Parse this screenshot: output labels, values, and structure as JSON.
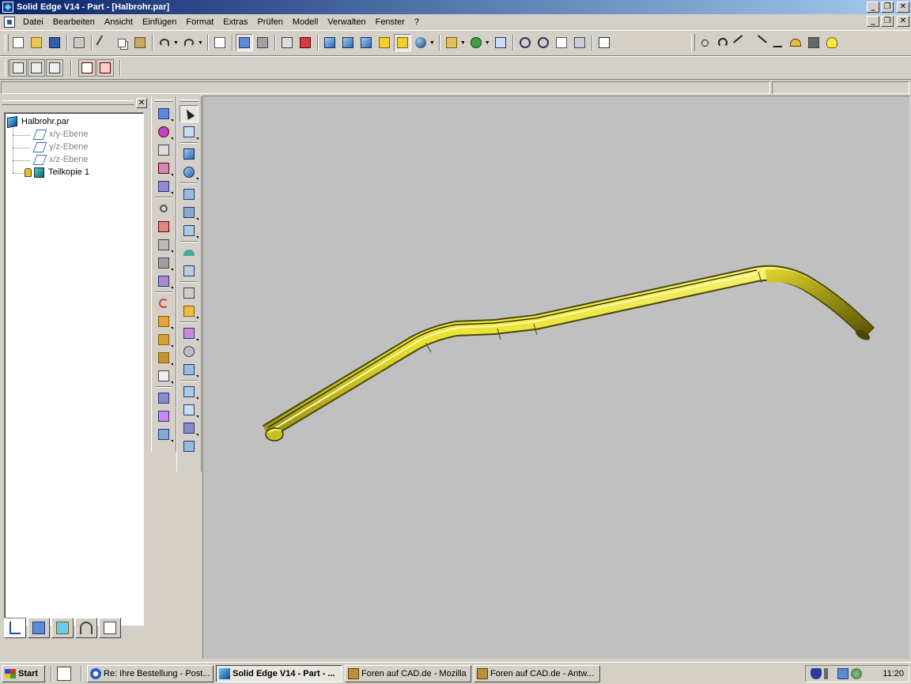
{
  "window": {
    "title": "Solid Edge V14 - Part - [Halbrohr.par]"
  },
  "menu": {
    "items": [
      "Datei",
      "Bearbeiten",
      "Ansicht",
      "Einfügen",
      "Format",
      "Extras",
      "Prüfen",
      "Modell",
      "Verwalten",
      "Fenster",
      "?"
    ]
  },
  "icons": {
    "standard_toolbar": [
      "new-icon",
      "open-icon",
      "save-icon",
      "print-icon",
      "cut-icon",
      "copy-icon",
      "paste-icon",
      "undo-icon",
      "redo-icon",
      "insert-icon",
      "select-icon",
      "sketch-icon",
      "view-icons",
      "shaded-icon",
      "globe-icon",
      "zoom-icon",
      "help-icon"
    ],
    "right_toolbar": [
      "point-icon",
      "arc-icon",
      "arrow-icon",
      "arrow-down-icon",
      "ground-icon",
      "arch-icon",
      "component-icon",
      "bulb-icon"
    ]
  },
  "tree": {
    "root": "Halbrohr.par",
    "planes": [
      "x/y-Ebene",
      "y/z-Ebene",
      "x/z-Ebene"
    ],
    "feature": "Teilkopie 1"
  },
  "colors": {
    "title_start": "#0a246a",
    "title_end": "#a6caf0",
    "viewport_bg": "#c0c0c0",
    "part_yellow": "#e8e030",
    "part_dark": "#8a8410"
  },
  "taskbar": {
    "start_label": "Start",
    "tasks": [
      {
        "label": "Re: Ihre Bestellung - Post...",
        "active": false
      },
      {
        "label": "Solid Edge V14 - Part - ...",
        "active": true
      },
      {
        "label": "Foren auf CAD.de - Mozilla",
        "active": false
      },
      {
        "label": "Foren auf CAD.de - Antw...",
        "active": false
      }
    ],
    "clock": "11:20"
  }
}
